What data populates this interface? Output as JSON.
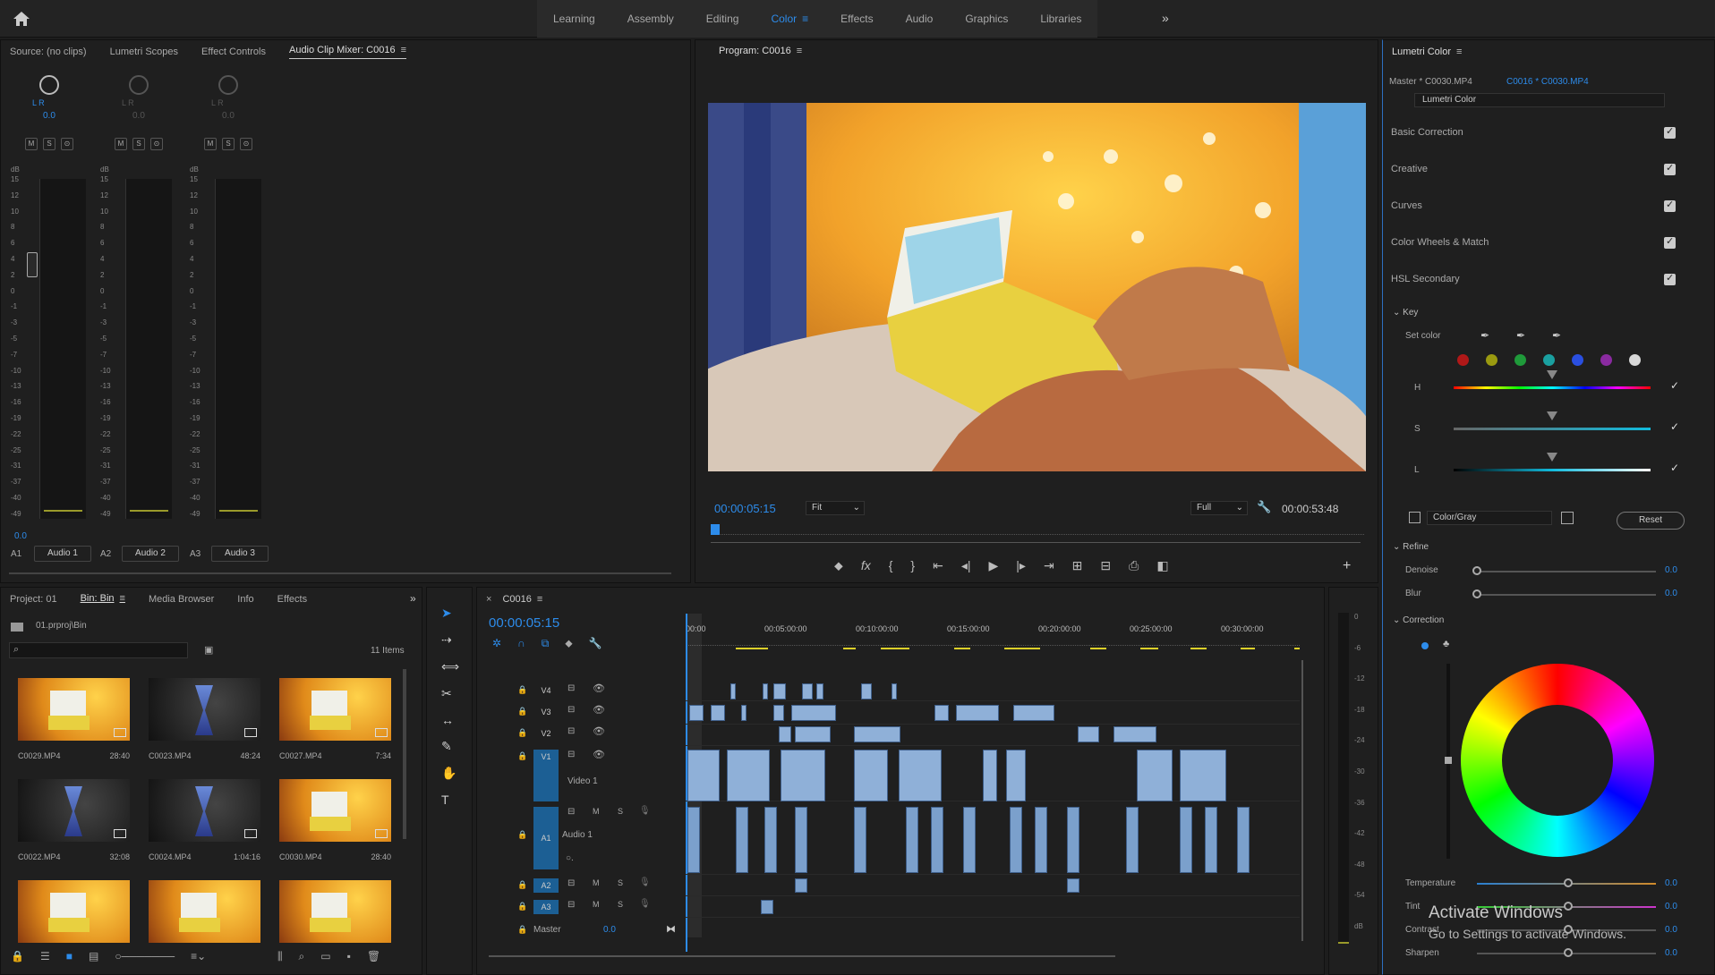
{
  "workspaces": {
    "tabs": [
      "Learning",
      "Assembly",
      "Editing",
      "Color",
      "Effects",
      "Audio",
      "Graphics",
      "Libraries"
    ],
    "active": "Color",
    "more": "»"
  },
  "source_panel": {
    "tabs": [
      "Source: (no clips)",
      "Lumetri Scopes",
      "Effect Controls",
      "Audio Clip Mixer: C0016"
    ],
    "active_tab": "Audio Clip Mixer: C0016",
    "channels": [
      {
        "id": "A1",
        "name": "Audio 1",
        "pan": "0.0",
        "lr": "L  R",
        "level": "0.0"
      },
      {
        "id": "A2",
        "name": "Audio 2",
        "pan": "0.0",
        "lr": "L  R",
        "level": ""
      },
      {
        "id": "A3",
        "name": "Audio 3",
        "pan": "0.0",
        "lr": "L  R",
        "level": ""
      }
    ],
    "db_label": "dB",
    "scale": [
      "15",
      "12",
      "10",
      "8",
      "6",
      "4",
      "2",
      "0",
      "-1",
      "-3",
      "-5",
      "-7",
      "-10",
      "-13",
      "-16",
      "-19",
      "-22",
      "-25",
      "-31",
      "-37",
      "-40",
      "-49"
    ],
    "ms_buttons": [
      "M",
      "S",
      "⊙"
    ]
  },
  "program": {
    "title": "Program: C0016",
    "timecode": "00:00:05:15",
    "fit": "Fit",
    "quality": "Full",
    "duration": "00:00:53:48"
  },
  "lumetri": {
    "title": "Lumetri Color",
    "master": "Master * C0030.MP4",
    "clip": "C0016 * C0030.MP4",
    "effect": "Lumetri Color",
    "sections": [
      "Basic Correction",
      "Creative",
      "Curves",
      "Color Wheels & Match",
      "HSL Secondary"
    ],
    "key_label": "Key",
    "set_color": "Set color",
    "swatches": [
      "#b01818",
      "#9a9a10",
      "#1f9a3a",
      "#1aa0a0",
      "#2a4fe0",
      "#8a2aa0",
      "#d8d8d8"
    ],
    "hsl": [
      "H",
      "S",
      "L"
    ],
    "color_gray": "Color/Gray",
    "reset": "Reset",
    "refine": "Refine",
    "denoise": {
      "label": "Denoise",
      "value": "0.0"
    },
    "blur": {
      "label": "Blur",
      "value": "0.0"
    },
    "correction": "Correction",
    "temperature": {
      "label": "Temperature",
      "value": "0.0"
    },
    "tint": {
      "label": "Tint",
      "value": "0.0"
    },
    "contrast": {
      "label": "Contrast",
      "value": "0.0"
    },
    "sharpen": {
      "label": "Sharpen",
      "value": "0.0"
    }
  },
  "project": {
    "tabs": [
      "Project: 01",
      "Bin: Bin",
      "Media Browser",
      "Info",
      "Effects"
    ],
    "active_tab": "Bin: Bin",
    "path": "01.prproj\\Bin",
    "items_count": "11 Items",
    "search_placeholder": "",
    "thumbs": [
      {
        "name": "C0029.MP4",
        "dur": "28:40",
        "kind": "box"
      },
      {
        "name": "C0023.MP4",
        "dur": "48:24",
        "kind": "hourglass"
      },
      {
        "name": "C0027.MP4",
        "dur": "7:34",
        "kind": "box"
      },
      {
        "name": "C0022.MP4",
        "dur": "32:08",
        "kind": "hourglass"
      },
      {
        "name": "C0024.MP4",
        "dur": "1:04:16",
        "kind": "hourglass"
      },
      {
        "name": "C0030.MP4",
        "dur": "28:40",
        "kind": "box"
      },
      {
        "name": "",
        "dur": "",
        "kind": "box"
      },
      {
        "name": "",
        "dur": "",
        "kind": "box"
      },
      {
        "name": "",
        "dur": "",
        "kind": "box"
      }
    ]
  },
  "timeline": {
    "sequence": "C0016",
    "timecode": "00:00:05:15",
    "ruler": [
      "00:00",
      "00:05:00:00",
      "00:10:00:00",
      "00:15:00:00",
      "00:20:00:00",
      "00:25:00:00",
      "00:30:00:00"
    ],
    "video_tracks": [
      "V4",
      "V3",
      "V2",
      "V1"
    ],
    "v1_name": "Video 1",
    "audio_tracks": [
      "A1",
      "A2",
      "A3"
    ],
    "a1_name": "Audio 1",
    "master": "Master",
    "master_value": "0.0",
    "track_btns": [
      "M",
      "S"
    ]
  },
  "meters": {
    "scale": [
      "0",
      "-6",
      "-12",
      "-18",
      "-24",
      "-30",
      "-36",
      "-42",
      "-48",
      "-54",
      "dB"
    ]
  },
  "watermark": {
    "line1": "Activate Windows",
    "line2": "Go to Settings to activate Windows."
  }
}
